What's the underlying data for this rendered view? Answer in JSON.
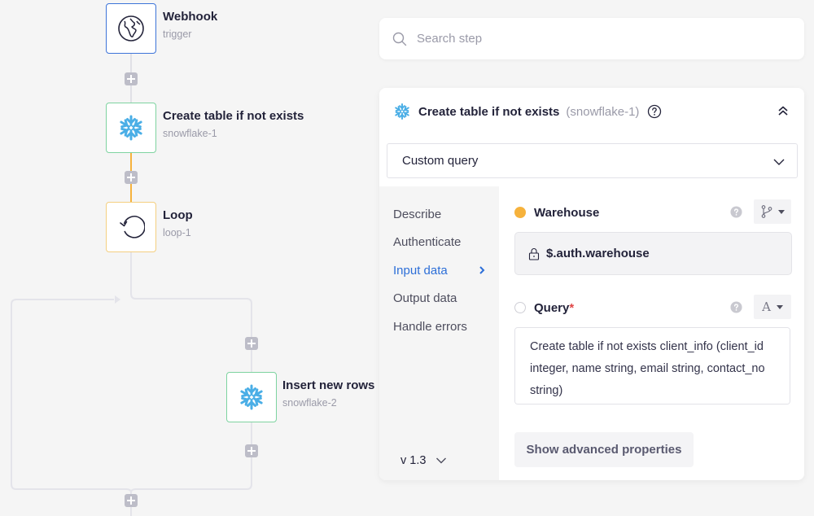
{
  "flow": {
    "nodes": [
      {
        "title": "Webhook",
        "subtitle": "trigger",
        "icon": "globe-icon",
        "kind": "trigger"
      },
      {
        "title": "Create table if not exists",
        "subtitle": "snowflake-1",
        "icon": "snowflake-icon",
        "kind": "snowflake"
      },
      {
        "title": "Loop",
        "subtitle": "loop-1",
        "icon": "loop-icon",
        "kind": "loop"
      },
      {
        "title": "Insert new rows",
        "subtitle": "snowflake-2",
        "icon": "snowflake-icon",
        "kind": "snowflake"
      }
    ],
    "add_step_label": "+"
  },
  "search": {
    "placeholder": "Search step",
    "value": ""
  },
  "panel": {
    "title": "Create table if not exists",
    "step_id": "(snowflake-1)",
    "mode_select": {
      "selected": "Custom query"
    },
    "nav": [
      {
        "label": "Describe",
        "active": false
      },
      {
        "label": "Authenticate",
        "active": false
      },
      {
        "label": "Input data",
        "active": true
      },
      {
        "label": "Output data",
        "active": false
      },
      {
        "label": "Handle errors",
        "active": false
      }
    ],
    "version": "v 1.3",
    "fields": {
      "warehouse": {
        "label": "Warehouse",
        "value": "$.auth.warehouse",
        "status": "filled",
        "locked": true,
        "type_icon": "branch-icon"
      },
      "query": {
        "label": "Query",
        "required_mark": "*",
        "value": "Create table if not exists client_info (client_id integer, name string, email string, contact_no string)",
        "status": "empty",
        "type_icon_label": "A"
      }
    },
    "advanced_button": "Show advanced properties"
  },
  "colors": {
    "accent": "#2d6fd8",
    "trigger_border": "#3d74d9",
    "snowflake_border": "#7ed3a0",
    "loop_border": "#f4cf80",
    "active_path": "#f6b23c",
    "snowflake_blue": "#4aaee6",
    "required": "#e04848"
  }
}
